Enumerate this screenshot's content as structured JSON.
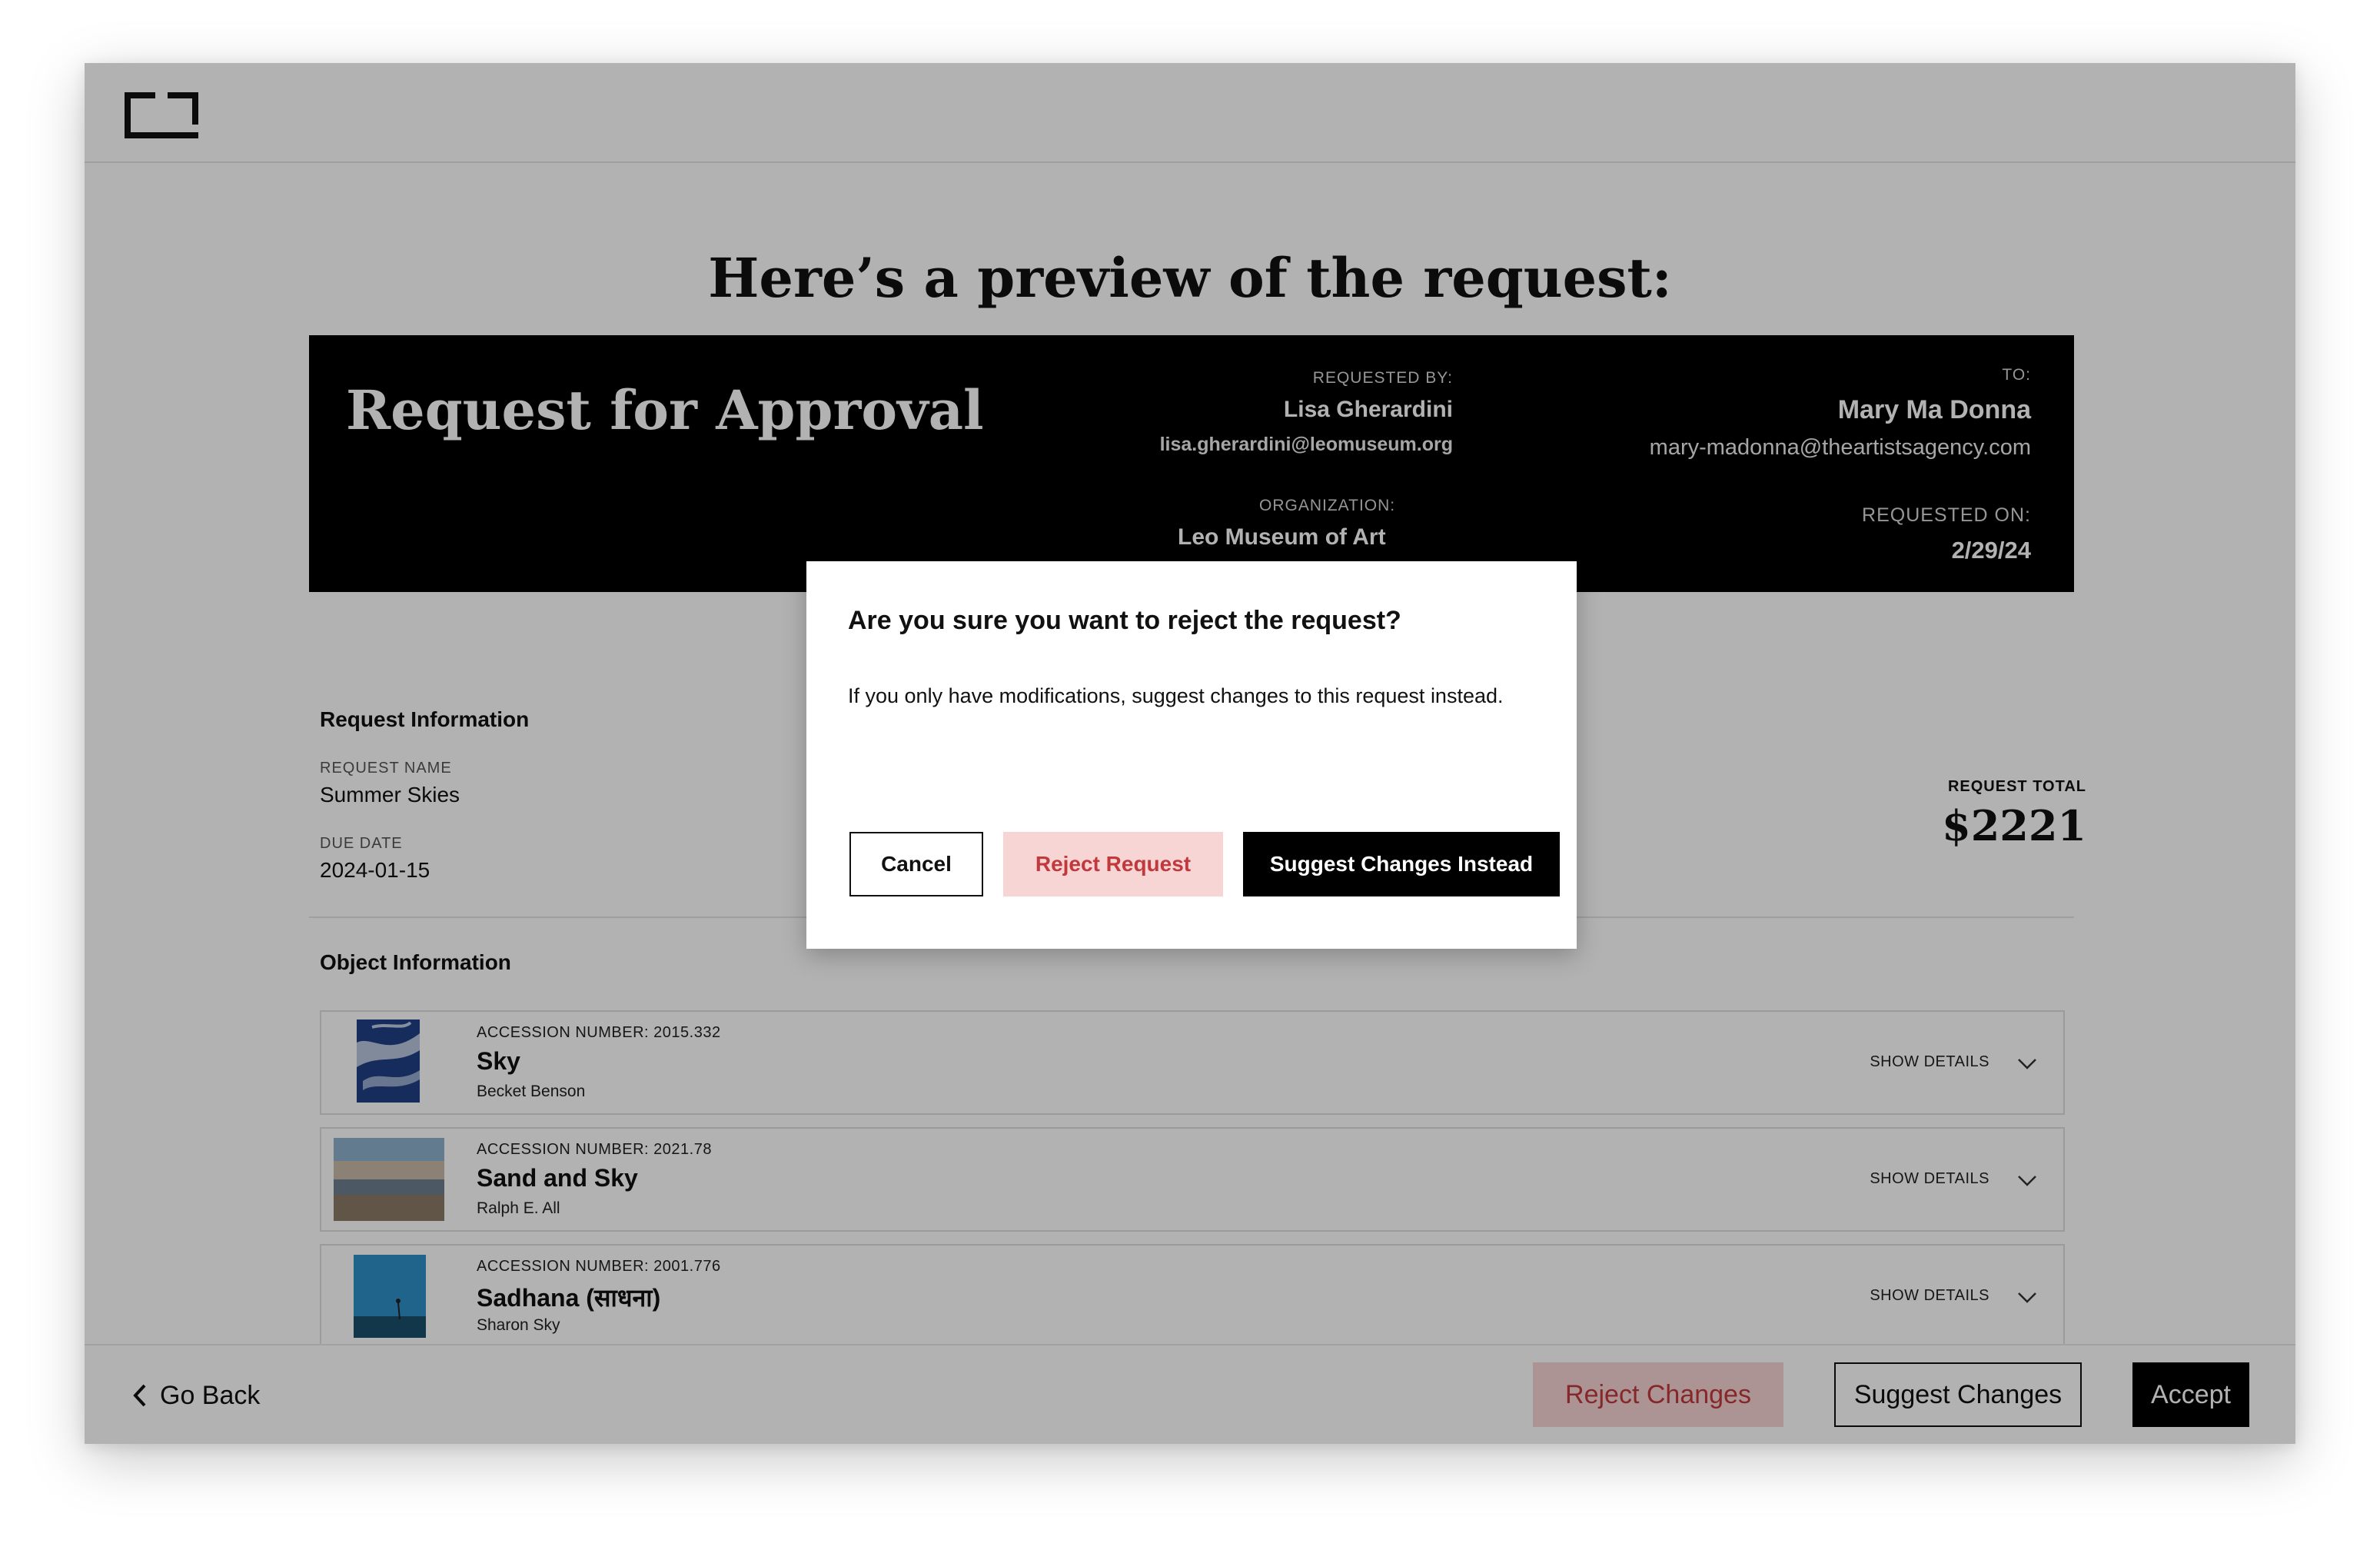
{
  "page": {
    "title": "Here’s a preview of the request:"
  },
  "request": {
    "heading": "Request for Approval",
    "requested_by_label": "REQUESTED BY:",
    "requested_by_name": "Lisa Gherardini",
    "requested_by_email": "lisa.gherardini@leomuseum.org",
    "organization_label": "ORGANIZATION:",
    "organization": "Leo Museum of Art",
    "to_label": "TO:",
    "to_name": "Mary Ma Donna",
    "to_email": "mary-madonna@theartistsagency.com",
    "requested_on_label": "REQUESTED ON:",
    "requested_on": "2/29/24"
  },
  "request_info": {
    "heading": "Request Information",
    "name_label": "REQUEST NAME",
    "name": "Summer Skies",
    "due_label": "DUE DATE",
    "due": "2024-01-15",
    "total_label": "REQUEST TOTAL",
    "total": "$2221"
  },
  "object_info": {
    "heading": "Object Information",
    "show_details_label": "SHOW DETAILS",
    "objects": [
      {
        "accession": "ACCESSION NUMBER: 2015.332",
        "title": "Sky",
        "artist": "Becket Benson"
      },
      {
        "accession": "ACCESSION NUMBER: 2021.78",
        "title": "Sand and Sky",
        "artist": "Ralph E. All"
      },
      {
        "accession": "ACCESSION NUMBER: 2001.776",
        "title": "Sadhana (साधना)",
        "artist": "Sharon Sky"
      }
    ]
  },
  "footer": {
    "go_back": "Go Back",
    "reject_changes": "Reject Changes",
    "suggest_changes": "Suggest Changes",
    "accept": "Accept"
  },
  "modal": {
    "title": "Are you sure you want to reject the request?",
    "body": "If you only have modifications, suggest changes to this request instead.",
    "cancel": "Cancel",
    "reject": "Reject Request",
    "suggest": "Suggest Changes Instead"
  },
  "colors": {
    "accent_reject_bg": "#f8d5d5",
    "accent_reject_text": "#c0393c",
    "primary": "#000000"
  },
  "icons": {
    "logo": "app-logo-icon",
    "back": "chevron-left-icon",
    "expand": "chevron-down-icon"
  }
}
